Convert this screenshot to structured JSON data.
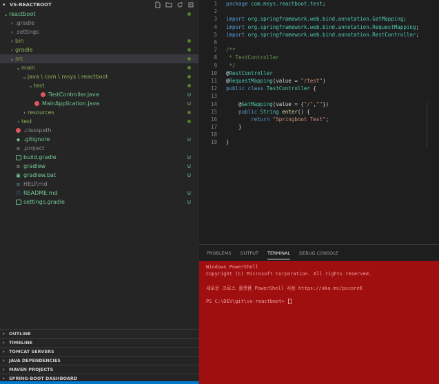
{
  "explorer": {
    "title": "VS-REACTBOOT"
  },
  "tree": [
    {
      "label": "reactboot",
      "depth": 0,
      "chev": "down",
      "icon": "none",
      "status": "dot",
      "color": "green"
    },
    {
      "label": ".gradle",
      "depth": 1,
      "chev": "right",
      "icon": "none",
      "status": "",
      "color": "muted"
    },
    {
      "label": ".settings",
      "depth": 1,
      "chev": "right",
      "icon": "none",
      "status": "",
      "color": "muted"
    },
    {
      "label": "bin",
      "depth": 1,
      "chev": "right",
      "icon": "none",
      "status": "dot",
      "color": "olive"
    },
    {
      "label": "gradle",
      "depth": 1,
      "chev": "right",
      "icon": "none",
      "status": "dot",
      "color": "olive"
    },
    {
      "label": "src",
      "depth": 1,
      "chev": "down",
      "icon": "none",
      "status": "dot",
      "color": "olive",
      "selected": true
    },
    {
      "label": "main",
      "depth": 2,
      "chev": "down",
      "icon": "none",
      "status": "dot",
      "color": "olive"
    },
    {
      "label": "java \\ com \\ msys \\ reactboot",
      "depth": 3,
      "chev": "down",
      "icon": "none",
      "status": "dot",
      "color": "olive"
    },
    {
      "label": "test",
      "depth": 4,
      "chev": "down",
      "icon": "none",
      "status": "dot",
      "color": "olive"
    },
    {
      "label": "TestController.java",
      "depth": 5,
      "chev": "none",
      "icon": "error",
      "status": "U",
      "color": "green",
      "active": true
    },
    {
      "label": "MainApplication.java",
      "depth": 4,
      "chev": "none",
      "icon": "error",
      "status": "U",
      "color": "green"
    },
    {
      "label": "resources",
      "depth": 3,
      "chev": "right",
      "icon": "none",
      "status": "dot",
      "color": "olive"
    },
    {
      "label": "test",
      "depth": 2,
      "chev": "right",
      "icon": "none",
      "status": "dot",
      "color": "olive"
    },
    {
      "label": ".classpath",
      "depth": 1,
      "chev": "none",
      "icon": "error",
      "status": "",
      "color": "muted"
    },
    {
      "label": ".gitignore",
      "depth": 1,
      "chev": "none",
      "icon": "diamond",
      "status": "U",
      "color": "green"
    },
    {
      "label": ".project",
      "depth": 1,
      "chev": "none",
      "icon": "lines",
      "status": "",
      "color": "muted"
    },
    {
      "label": "build.gradle",
      "depth": 1,
      "chev": "none",
      "icon": "gradle",
      "status": "U",
      "color": "green"
    },
    {
      "label": "gradlew",
      "depth": 1,
      "chev": "none",
      "icon": "lines",
      "status": "U",
      "color": "green"
    },
    {
      "label": "gradlew.bat",
      "depth": 1,
      "chev": "none",
      "icon": "win",
      "status": "U",
      "color": "green"
    },
    {
      "label": "HELP.md",
      "depth": 1,
      "chev": "none",
      "icon": "md",
      "status": "",
      "color": "muted"
    },
    {
      "label": "README.md",
      "depth": 1,
      "chev": "none",
      "icon": "info",
      "status": "U",
      "color": "green"
    },
    {
      "label": "settings.gradle",
      "depth": 1,
      "chev": "none",
      "icon": "gradle",
      "status": "U",
      "color": "green"
    }
  ],
  "sections": [
    "OUTLINE",
    "TIMELINE",
    "TOMCAT SERVERS",
    "JAVA DEPENDENCIES",
    "MAVEN PROJECTS",
    "SPRING-BOOT DASHBOARD"
  ],
  "code_lines": [
    [
      {
        "t": "package ",
        "c": "kw"
      },
      {
        "t": "com.msys.reactboot.test",
        "c": "ty"
      },
      {
        "t": ";",
        "c": ""
      }
    ],
    [],
    [
      {
        "t": "import ",
        "c": "kw"
      },
      {
        "t": "org.springframework.web.bind.annotation.GetMapping",
        "c": "ty"
      },
      {
        "t": ";",
        "c": ""
      }
    ],
    [
      {
        "t": "import ",
        "c": "kw"
      },
      {
        "t": "org.springframework.web.bind.annotation.RequestMapping",
        "c": "ty"
      },
      {
        "t": ";",
        "c": ""
      }
    ],
    [
      {
        "t": "import ",
        "c": "kw"
      },
      {
        "t": "org.springframework.web.bind.annotation.RestController",
        "c": "ty"
      },
      {
        "t": ";",
        "c": ""
      }
    ],
    [],
    [
      {
        "t": "/**",
        "c": "cm"
      }
    ],
    [
      {
        "t": " * TestController",
        "c": "cm"
      }
    ],
    [
      {
        "t": " */",
        "c": "cm"
      }
    ],
    [
      {
        "t": "@",
        "c": ""
      },
      {
        "t": "RestController",
        "c": "ty"
      }
    ],
    [
      {
        "t": "@",
        "c": ""
      },
      {
        "t": "RequestMapping",
        "c": "ty"
      },
      {
        "t": "(value = ",
        "c": ""
      },
      {
        "t": "\"/test\"",
        "c": "str"
      },
      {
        "t": ")",
        "c": ""
      }
    ],
    [
      {
        "t": "public ",
        "c": "kw"
      },
      {
        "t": "class ",
        "c": "kw"
      },
      {
        "t": "TestController",
        "c": "ty"
      },
      {
        "t": " {",
        "c": ""
      }
    ],
    [],
    [
      {
        "t": "    @",
        "c": ""
      },
      {
        "t": "GetMapping",
        "c": "ty"
      },
      {
        "t": "(value = {",
        "c": ""
      },
      {
        "t": "\"/\"",
        "c": "str"
      },
      {
        "t": ",",
        "c": ""
      },
      {
        "t": "\"\"",
        "c": "str"
      },
      {
        "t": "})",
        "c": ""
      }
    ],
    [
      {
        "t": "    public ",
        "c": "kw"
      },
      {
        "t": "String ",
        "c": "ty"
      },
      {
        "t": "enter",
        "c": "fn"
      },
      {
        "t": "() {",
        "c": ""
      }
    ],
    [
      {
        "t": "        return ",
        "c": "kw"
      },
      {
        "t": "\"Springboot Test\"",
        "c": "str"
      },
      {
        "t": ";",
        "c": ""
      }
    ],
    [
      {
        "t": "    }",
        "c": ""
      }
    ],
    [],
    [
      {
        "t": "}",
        "c": ""
      }
    ]
  ],
  "panel": {
    "tabs": [
      "PROBLEMS",
      "OUTPUT",
      "TERMINAL",
      "DEBUG CONSOLE"
    ],
    "active_tab": "TERMINAL",
    "terminal_lines": [
      "Windows PowerShell",
      "Copyright (C) Microsoft Corporation. All rights reserved.",
      "",
      "새로운 크로스 플랫폼 PowerShell 사용 https://aka.ms/pscore6",
      "",
      "PS C:\\DEV\\git\\vs-reactboot> "
    ]
  },
  "colors": {
    "terminal_bg": "#a00f0f",
    "sidebar_bg": "#252526",
    "editor_bg": "#1e1e1e",
    "untracked": "#73c991",
    "error": "#e2565e"
  }
}
